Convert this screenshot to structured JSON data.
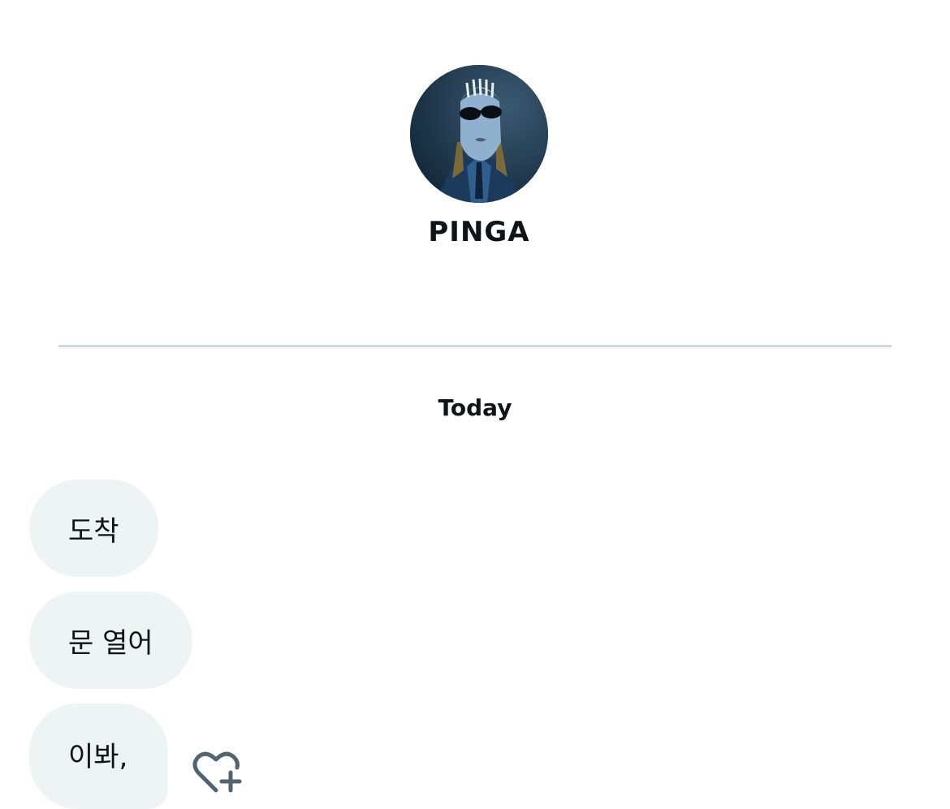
{
  "profile": {
    "name": "PINGA",
    "avatar_icon": "profile-avatar"
  },
  "conversation": {
    "date_label": "Today",
    "messages": [
      {
        "text": "도착"
      },
      {
        "text": "문 열어"
      },
      {
        "text": "이봐,"
      }
    ],
    "reaction_icon": "heart-plus-icon"
  },
  "colors": {
    "bubble_bg": "#eef3f4",
    "divider": "#cfd9de",
    "text": "#0f1419",
    "icon": "#536471"
  }
}
